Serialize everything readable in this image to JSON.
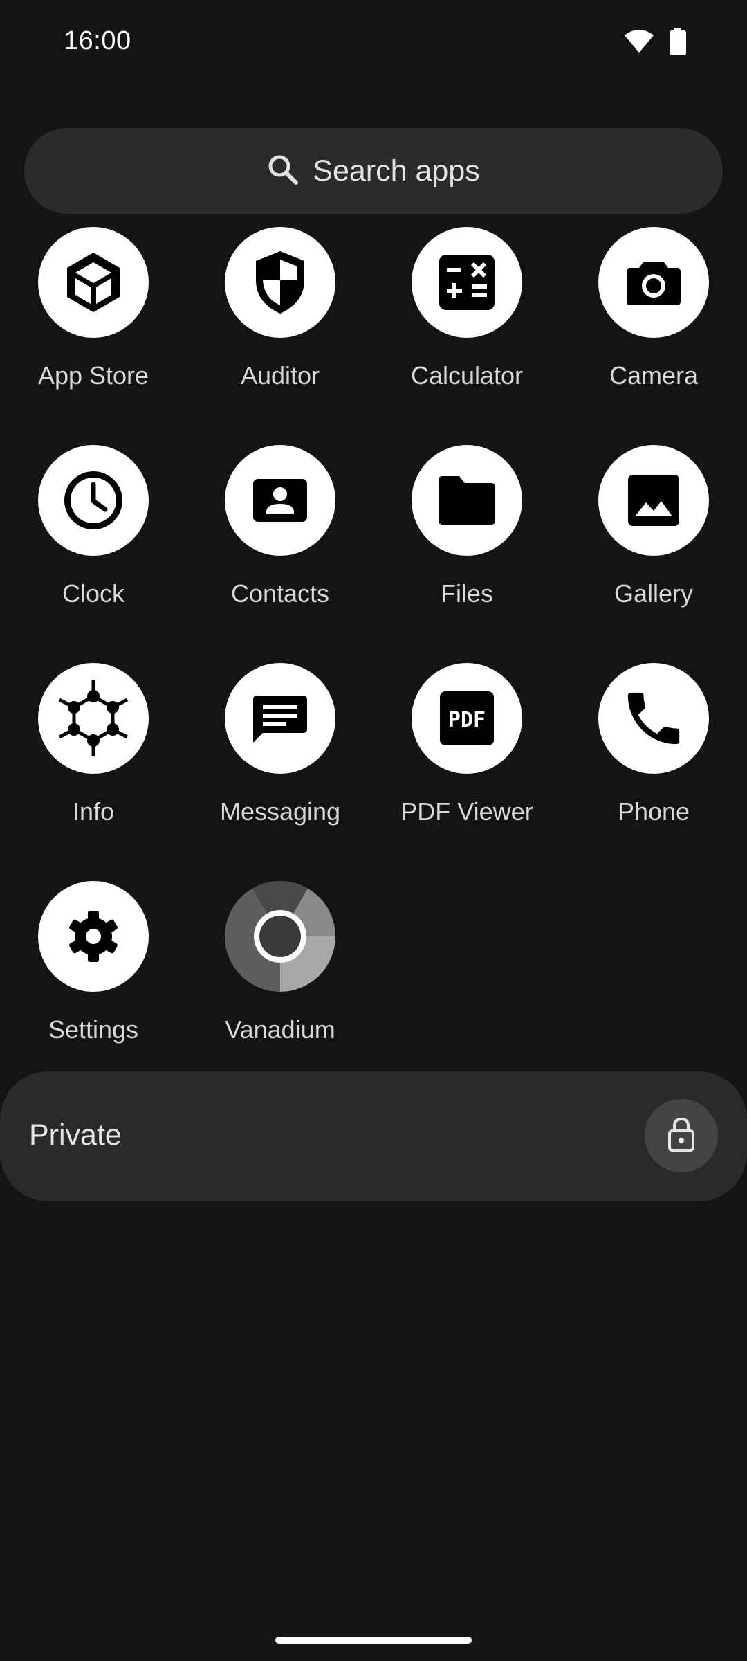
{
  "status_bar": {
    "time": "16:00",
    "icons": [
      "wifi-icon",
      "battery-icon"
    ]
  },
  "search": {
    "placeholder": "Search apps",
    "icon": "search-icon"
  },
  "apps": [
    {
      "label": "App Store",
      "icon": "package-icon"
    },
    {
      "label": "Auditor",
      "icon": "shield-icon"
    },
    {
      "label": "Calculator",
      "icon": "calculator-icon"
    },
    {
      "label": "Camera",
      "icon": "camera-icon"
    },
    {
      "label": "Clock",
      "icon": "clock-icon"
    },
    {
      "label": "Contacts",
      "icon": "contact-card-icon"
    },
    {
      "label": "Files",
      "icon": "folder-icon"
    },
    {
      "label": "Gallery",
      "icon": "image-icon"
    },
    {
      "label": "Info",
      "icon": "hexagon-network-icon"
    },
    {
      "label": "Messaging",
      "icon": "message-icon"
    },
    {
      "label": "PDF Viewer",
      "icon": "pdf-icon"
    },
    {
      "label": "Phone",
      "icon": "phone-icon"
    },
    {
      "label": "Settings",
      "icon": "gear-icon"
    },
    {
      "label": "Vanadium",
      "icon": "browser-icon"
    }
  ],
  "private_space": {
    "label": "Private",
    "lock_icon": "lock-icon"
  },
  "colors": {
    "background": "#141414",
    "surface": "#2a2a2a",
    "icon_bg": "#ffffff",
    "text": "#d9d9d9"
  }
}
